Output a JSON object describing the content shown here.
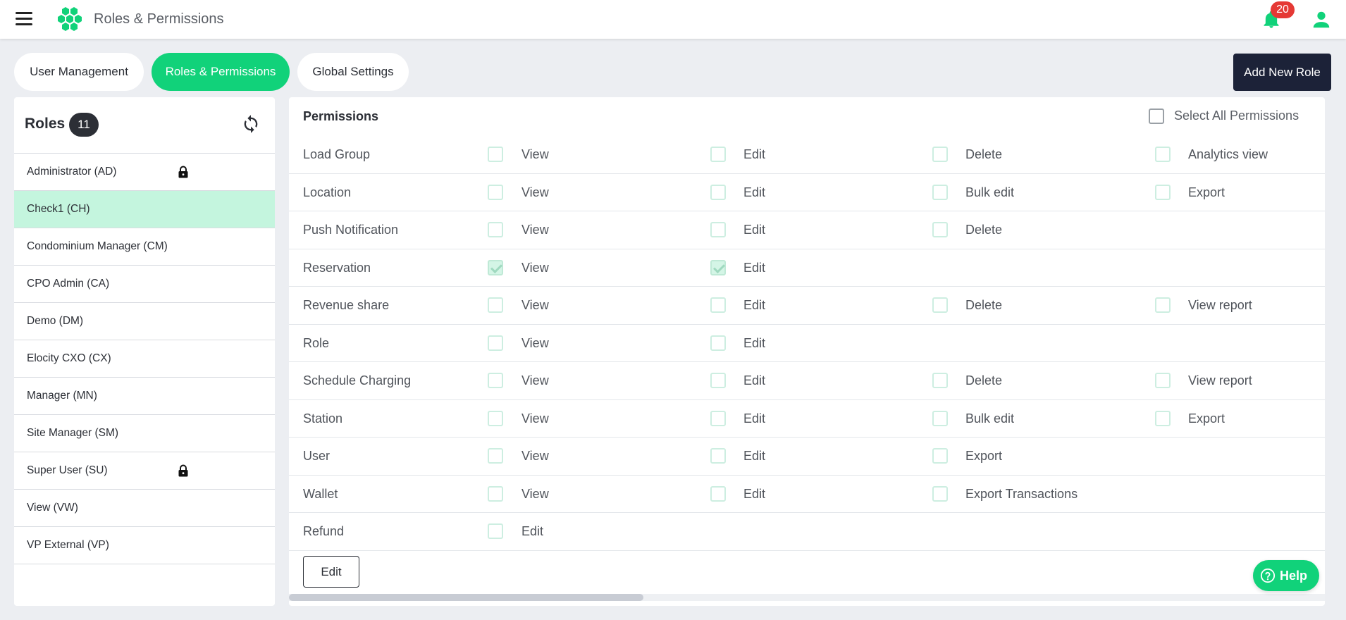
{
  "header": {
    "title": "Roles & Permissions",
    "notification_count": "20"
  },
  "tabs": [
    {
      "label": "User Management"
    },
    {
      "label": "Roles & Permissions"
    },
    {
      "label": "Global Settings"
    }
  ],
  "add_role_label": "Add New Role",
  "roles": {
    "title": "Roles",
    "count": "11",
    "items": [
      {
        "label": "Administrator (AD)",
        "locked": true
      },
      {
        "label": "Check1 (CH)",
        "selected": true
      },
      {
        "label": "Condominium Manager (CM)"
      },
      {
        "label": "CPO Admin (CA)"
      },
      {
        "label": "Demo (DM)"
      },
      {
        "label": "Elocity CXO (CX)"
      },
      {
        "label": "Manager (MN)"
      },
      {
        "label": "Site Manager (SM)"
      },
      {
        "label": "Super User (SU)",
        "locked": true
      },
      {
        "label": "View (VW)"
      },
      {
        "label": "VP External (VP)"
      }
    ]
  },
  "permissions": {
    "title": "Permissions",
    "select_all_label": "Select All Permissions",
    "rows": [
      {
        "name": "Load Group",
        "perms": [
          {
            "label": "View"
          },
          {
            "label": "Edit"
          },
          {
            "label": "Delete"
          },
          {
            "label": "Analytics view"
          }
        ]
      },
      {
        "name": "Location",
        "perms": [
          {
            "label": "View"
          },
          {
            "label": "Edit"
          },
          {
            "label": "Bulk edit"
          },
          {
            "label": "Export"
          }
        ]
      },
      {
        "name": "Push Notification",
        "perms": [
          {
            "label": "View"
          },
          {
            "label": "Edit"
          },
          {
            "label": "Delete"
          }
        ]
      },
      {
        "name": "Reservation",
        "perms": [
          {
            "label": "View",
            "checked": true
          },
          {
            "label": "Edit",
            "checked": true
          }
        ]
      },
      {
        "name": "Revenue share",
        "perms": [
          {
            "label": "View"
          },
          {
            "label": "Edit"
          },
          {
            "label": "Delete"
          },
          {
            "label": "View report"
          }
        ]
      },
      {
        "name": "Role",
        "perms": [
          {
            "label": "View"
          },
          {
            "label": "Edit"
          }
        ]
      },
      {
        "name": "Schedule Charging",
        "perms": [
          {
            "label": "View"
          },
          {
            "label": "Edit"
          },
          {
            "label": "Delete"
          },
          {
            "label": "View report"
          }
        ]
      },
      {
        "name": "Station",
        "perms": [
          {
            "label": "View"
          },
          {
            "label": "Edit"
          },
          {
            "label": "Bulk edit"
          },
          {
            "label": "Export"
          }
        ]
      },
      {
        "name": "User",
        "perms": [
          {
            "label": "View"
          },
          {
            "label": "Edit"
          },
          {
            "label": "Export"
          }
        ]
      },
      {
        "name": "Wallet",
        "perms": [
          {
            "label": "View"
          },
          {
            "label": "Edit"
          },
          {
            "label": "Export Transactions"
          }
        ]
      },
      {
        "name": "Refund",
        "perms": [
          {
            "label": "Edit"
          }
        ]
      }
    ],
    "edit_label": "Edit"
  },
  "help_label": "Help",
  "colors": {
    "accent": "#11d27a",
    "dark": "#1c2238",
    "selected_role_bg": "#c4f5de",
    "badge": "#e53935"
  }
}
